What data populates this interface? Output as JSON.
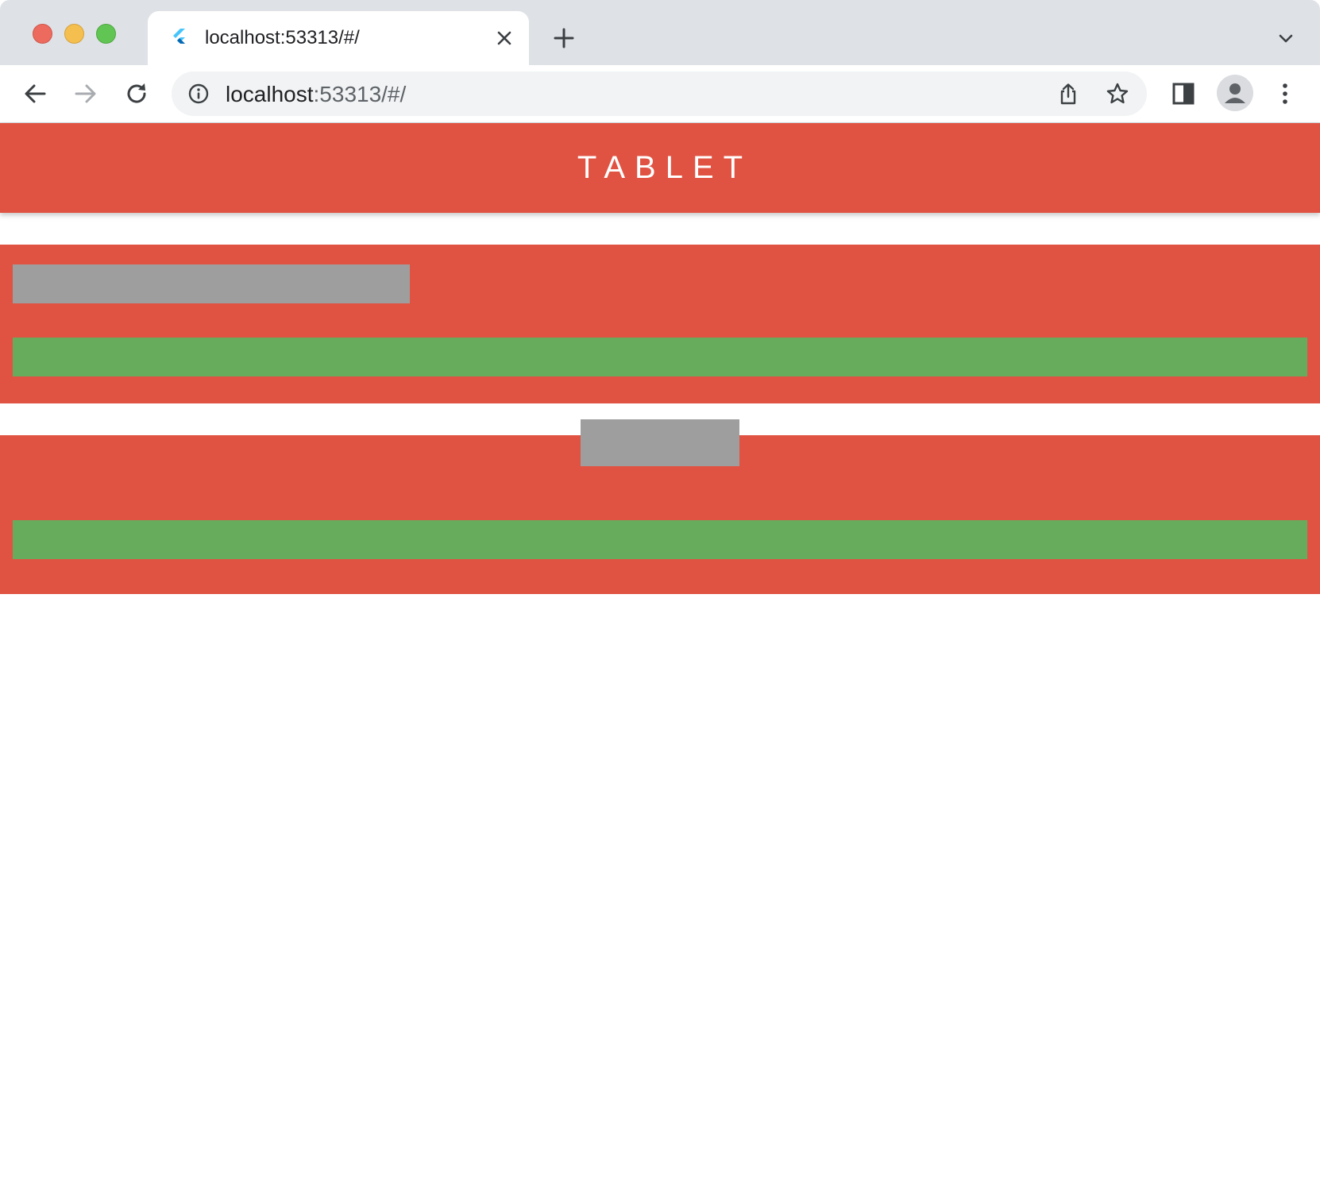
{
  "browser": {
    "tab": {
      "title": "localhost:53313/#/",
      "favicon": "flutter-icon"
    },
    "address_bar": {
      "url_host": "localhost",
      "url_rest": ":53313/#/"
    },
    "icons": {
      "back": "back-arrow-icon",
      "forward": "forward-arrow-icon",
      "reload": "reload-icon",
      "site_info": "info-icon",
      "share": "share-icon",
      "bookmark": "star-icon",
      "side_panel": "side-panel-icon",
      "profile": "profile-avatar-icon",
      "menu": "more-vertical-icon",
      "new_tab": "plus-icon",
      "close_tab": "close-icon",
      "tab_search": "chevron-down-icon"
    }
  },
  "app": {
    "title": "TABLET",
    "colors": {
      "primary": "#e05343",
      "placeholder_gray": "#9e9e9e",
      "placeholder_green": "#66ac5c"
    }
  }
}
